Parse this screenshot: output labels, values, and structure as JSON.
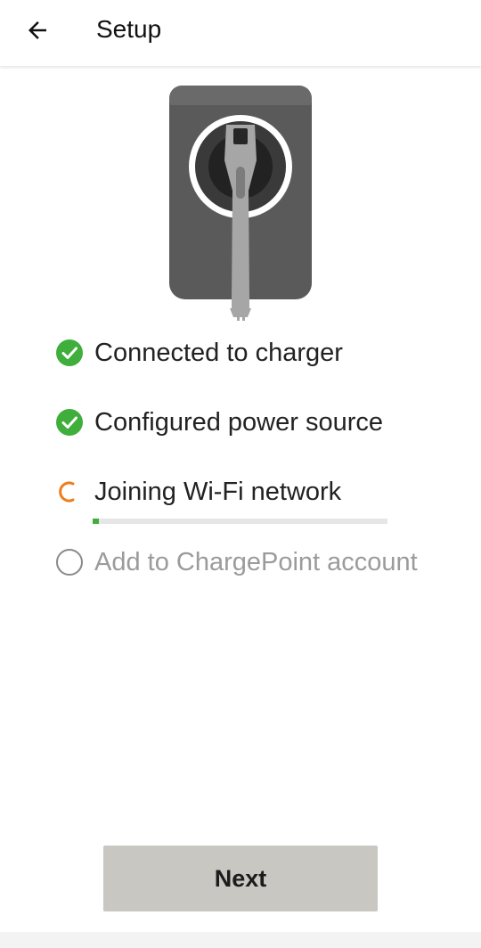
{
  "header": {
    "title": "Setup",
    "back_icon": "arrow-left-icon"
  },
  "illustration": {
    "icon": "charger-plug-illustration"
  },
  "steps": [
    {
      "label": "Connected to charger",
      "status": "done",
      "icon": "check-circle-icon"
    },
    {
      "label": "Configured power source",
      "status": "done",
      "icon": "check-circle-icon"
    },
    {
      "label": "Joining Wi-Fi network",
      "status": "in-progress",
      "icon": "spinner-icon",
      "progress": 0.02
    },
    {
      "label": "Add to ChargePoint account",
      "status": "pending",
      "icon": "empty-circle-icon"
    }
  ],
  "footer": {
    "next_label": "Next"
  },
  "colors": {
    "success": "#3fae3b",
    "spinner": "#ee7d1a",
    "button_bg": "#c8c7c2",
    "pending_text": "#9b9b9b"
  }
}
